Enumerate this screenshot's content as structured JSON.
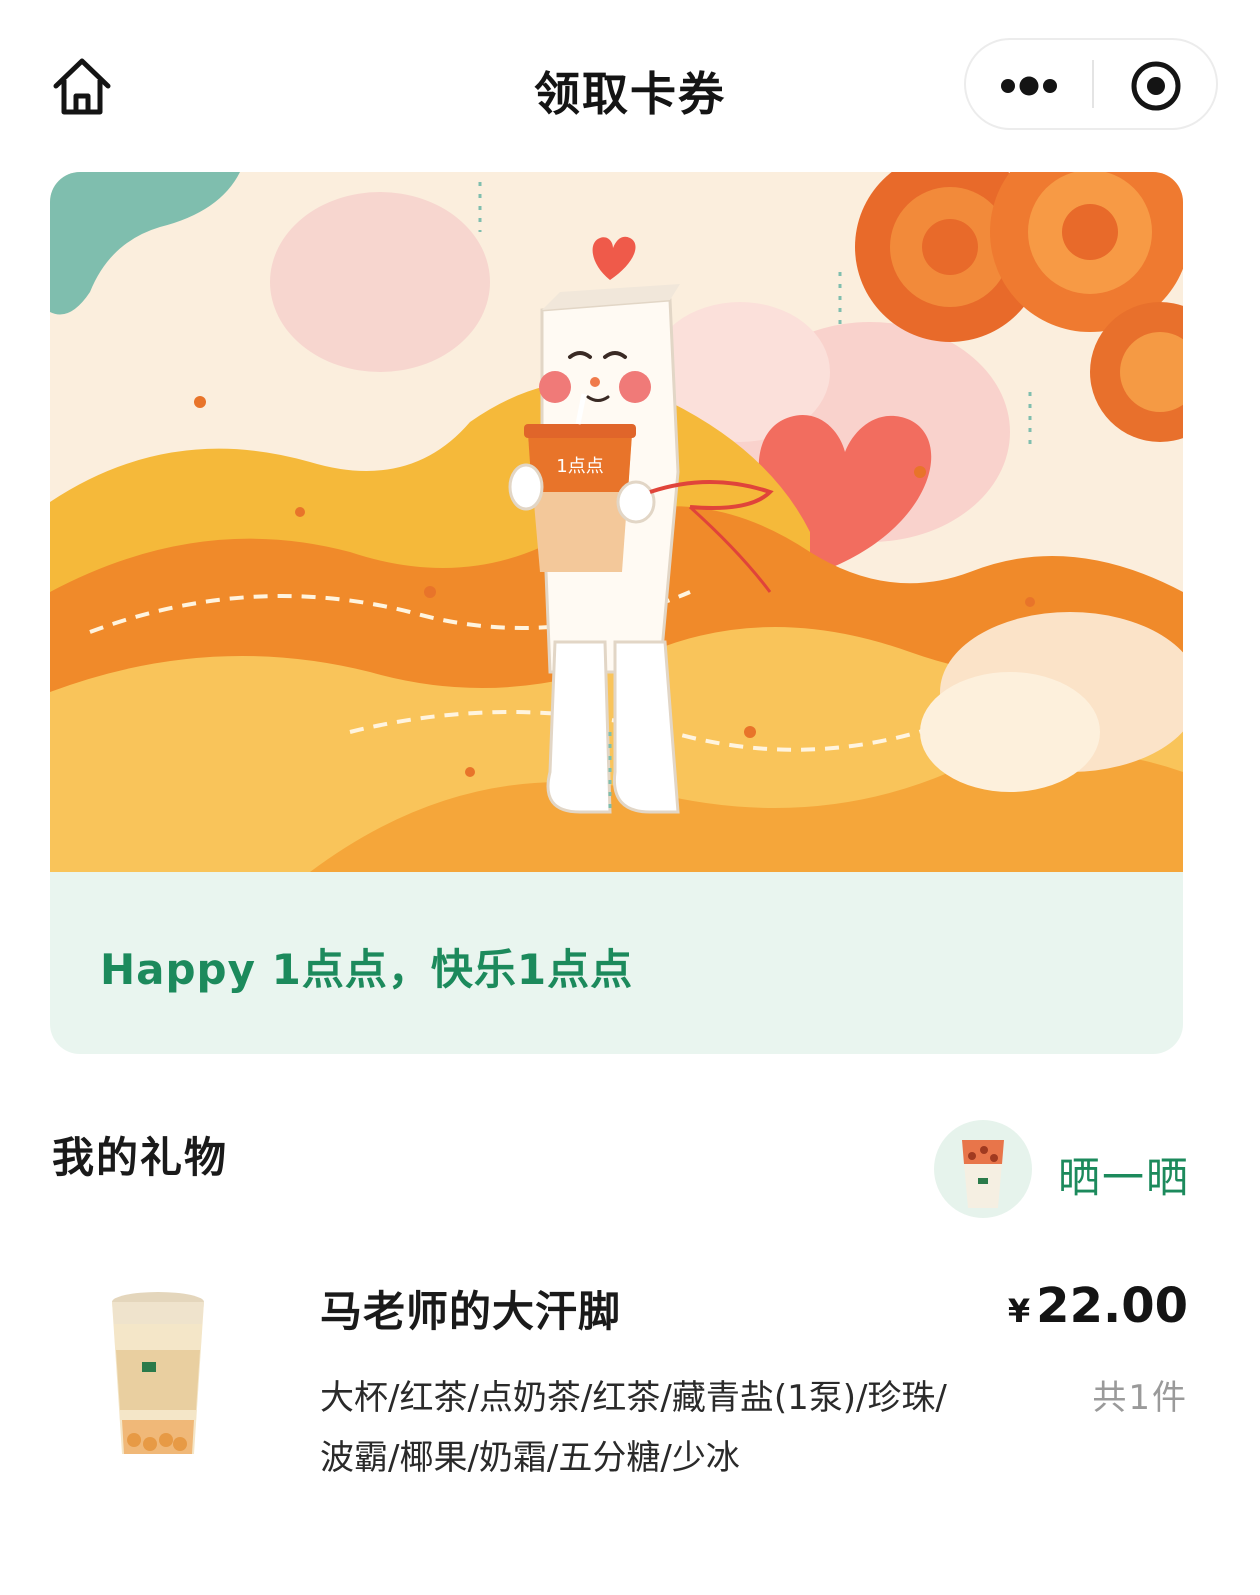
{
  "header": {
    "title": "领取卡券",
    "icons": {
      "home": "home-icon",
      "more": "more-dots-icon",
      "close": "target-circle-icon"
    }
  },
  "card": {
    "illustration_text": "1点点",
    "message": "Happy 1点点，快乐1点点"
  },
  "gift_section": {
    "title": "我的礼物",
    "share_label": "晒一晒"
  },
  "product": {
    "name": "马老师的大汗脚",
    "spec": "大杯/红茶/点奶茶/红茶/藏青盐(1泵)/珍珠/波霸/椰果/奶霜/五分糖/少冰",
    "currency": "¥",
    "price": "22.00",
    "quantity": "共1件"
  },
  "colors": {
    "brand_green": "#1c8a5c",
    "card_bg": "#e9f5ef",
    "orange": "#f08a2a"
  }
}
